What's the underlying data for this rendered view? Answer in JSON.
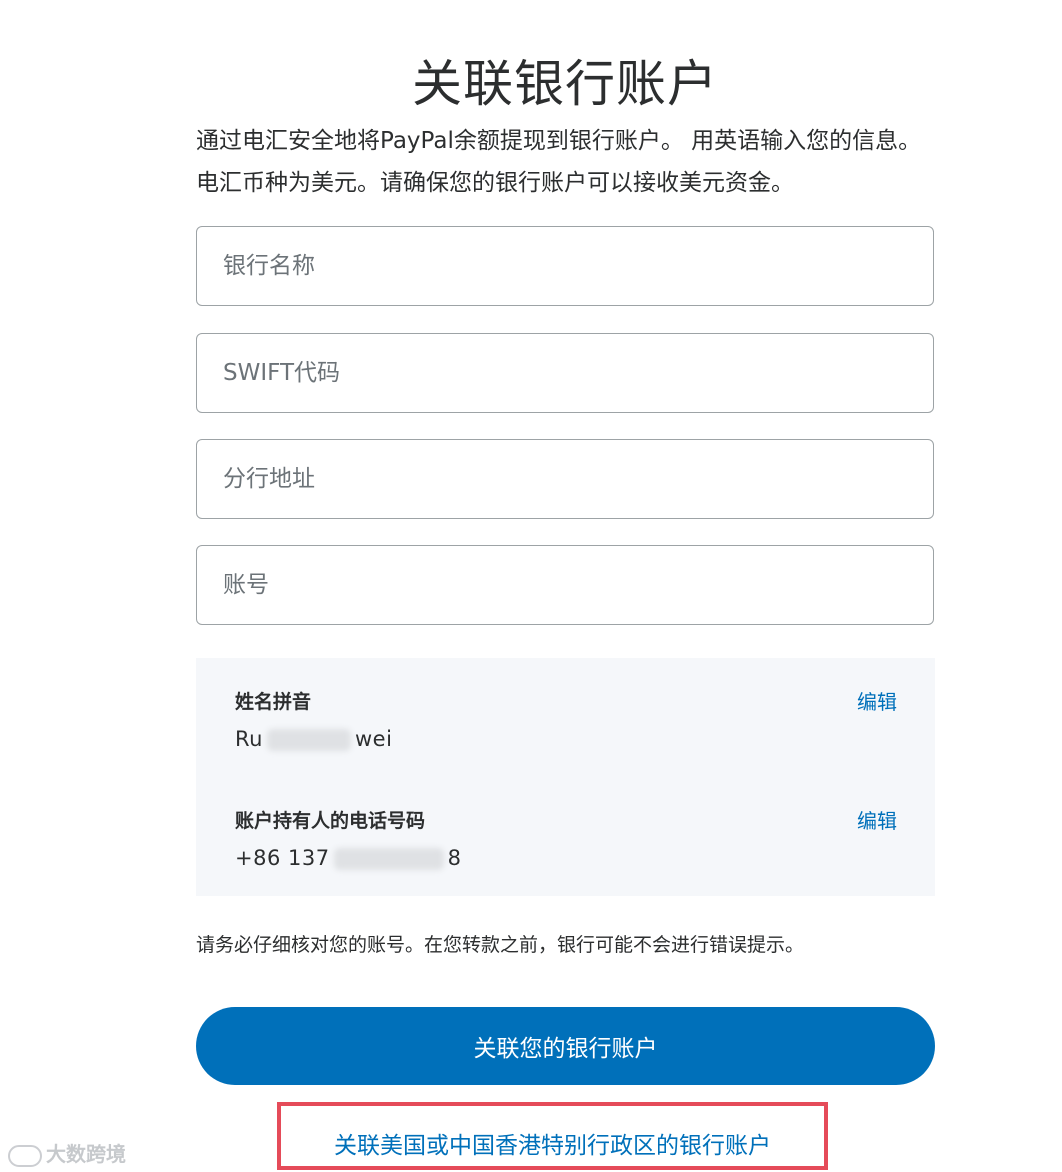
{
  "title": "关联银行账户",
  "intro": "通过电汇安全地将PayPal余额提现到银行账户。 用英语输入您的信息。电汇币种为美元。请确保您的银行账户可以接收美元资金。",
  "fields": {
    "bank_name": {
      "placeholder": "银行名称",
      "value": ""
    },
    "swift": {
      "placeholder": "SWIFT代码",
      "value": ""
    },
    "branch": {
      "placeholder": "分行地址",
      "value": ""
    },
    "account": {
      "placeholder": "账号",
      "value": ""
    }
  },
  "info": {
    "name_label": "姓名拼音",
    "name_prefix": "Ru",
    "name_suffix": "wei",
    "phone_label": "账户持有人的电话号码",
    "phone_prefix": "+86 137",
    "phone_suffix": "8",
    "edit_label": "编辑"
  },
  "notice": "请务必仔细核对您的账号。在您转款之前，银行可能不会进行错误提示。",
  "primary_button": "关联您的银行账户",
  "alt_link": "关联美国或中国香港特别行政区的银行账户",
  "watermark": "大数跨境",
  "colors": {
    "accent": "#0070ba",
    "panel": "#f5f7fa",
    "highlight": "#e54b59"
  }
}
